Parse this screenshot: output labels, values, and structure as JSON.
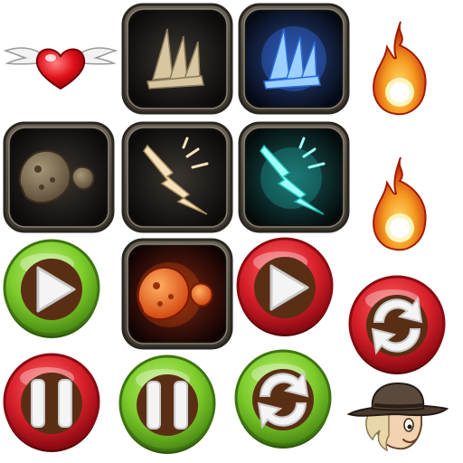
{
  "sprite_sheet": {
    "items": [
      {
        "name": "winged-heart",
        "kind": "decoration",
        "color": "#e0101a"
      },
      {
        "name": "spikes-skill-bronze",
        "kind": "skill-tile",
        "color": "#d8c6a0"
      },
      {
        "name": "spikes-skill-blue",
        "kind": "skill-tile",
        "color": "#5aa8ff"
      },
      {
        "name": "fire-flame",
        "kind": "decoration",
        "color": "#f05a10"
      },
      {
        "name": "boulder-skill-bronze",
        "kind": "skill-tile",
        "color": "#8a7a60"
      },
      {
        "name": "lightning-skill-bronze",
        "kind": "skill-tile",
        "color": "#f0dcb0"
      },
      {
        "name": "lightning-skill-cyan",
        "kind": "skill-tile",
        "color": "#3ff0e8"
      },
      {
        "name": "fire-flame",
        "kind": "decoration",
        "color": "#f05a10"
      },
      {
        "name": "play-button-green",
        "kind": "button",
        "color": "#7ccc2a"
      },
      {
        "name": "boulder-skill-red",
        "kind": "skill-tile",
        "color": "#f06a1a"
      },
      {
        "name": "play-button-red",
        "kind": "button",
        "color": "#d8202a"
      },
      {
        "name": "refresh-button-red",
        "kind": "button",
        "color": "#d8202a"
      },
      {
        "name": "pause-button-red",
        "kind": "button",
        "color": "#d8202a"
      },
      {
        "name": "pause-button-green",
        "kind": "button",
        "color": "#7ccc2a"
      },
      {
        "name": "refresh-button-green",
        "kind": "button",
        "color": "#7ccc2a"
      },
      {
        "name": "cowboy-avatar",
        "kind": "character",
        "color": "#5a4a3e"
      }
    ]
  }
}
